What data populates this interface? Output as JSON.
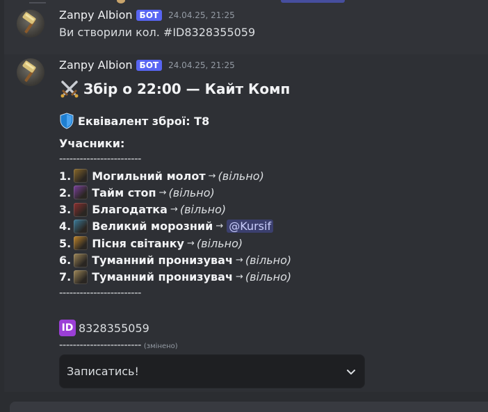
{
  "messages": [
    {
      "username": "Zanpy Albion",
      "badge": "БОТ",
      "timestamp": "24.04.25, 21:25",
      "text": "Ви створили кол. #ID8328355059"
    },
    {
      "username": "Zanpy Albion",
      "badge": "БОТ",
      "timestamp": "24.04.25, 21:25",
      "embed": {
        "title": "Збір о 22:00 — Кайт Комп",
        "title_icon": "crossed-swords-icon",
        "equivalent": "Еквівалент зброї: Т8",
        "equivalent_icon": "shield-icon",
        "participants_label": "Учасники:",
        "separator": "------------------------",
        "slots": [
          {
            "number": "1.",
            "weapon": "Могильний молот",
            "arrow": "→",
            "occupant": "(вільно)",
            "mention": false,
            "icon": "grave-hammer-icon",
            "color": "#8b6a2a"
          },
          {
            "number": "2.",
            "weapon": "Тайм стоп",
            "arrow": "→",
            "occupant": "(вільно)",
            "mention": false,
            "icon": "timestop-staff-icon",
            "color": "#7a3f9d"
          },
          {
            "number": "3.",
            "weapon": "Благодатка",
            "arrow": "→",
            "occupant": "(вільно)",
            "mention": false,
            "icon": "blessed-staff-icon",
            "color": "#8d2f2f"
          },
          {
            "number": "4.",
            "weapon": "Великий морозний",
            "arrow": "→",
            "occupant": "@Kursif",
            "mention": true,
            "icon": "great-frost-staff-icon",
            "color": "#3a7c9c"
          },
          {
            "number": "5.",
            "weapon": "Пісня світанку",
            "arrow": "→",
            "occupant": "(вільно)",
            "mention": false,
            "icon": "dawnsong-icon",
            "color": "#c1862a"
          },
          {
            "number": "6.",
            "weapon": "Туманний пронизувач",
            "arrow": "→",
            "occupant": "(вільно)",
            "mention": false,
            "icon": "mistpiercer-icon",
            "color": "#a08858"
          },
          {
            "number": "7.",
            "weapon": "Туманний пронизувач",
            "arrow": "→",
            "occupant": "(вільно)",
            "mention": false,
            "icon": "mistpiercer-icon",
            "color": "#a08858"
          }
        ],
        "id_badge": "ID",
        "id_value": "8328355059",
        "edited_label": "(змінено)"
      },
      "select": {
        "placeholder": "Записатись!"
      }
    }
  ],
  "colors": {
    "background": "#313338",
    "bot_badge": "#5865f2",
    "id_badge": "#9b3fd6",
    "shield": "#1f7fd1"
  }
}
